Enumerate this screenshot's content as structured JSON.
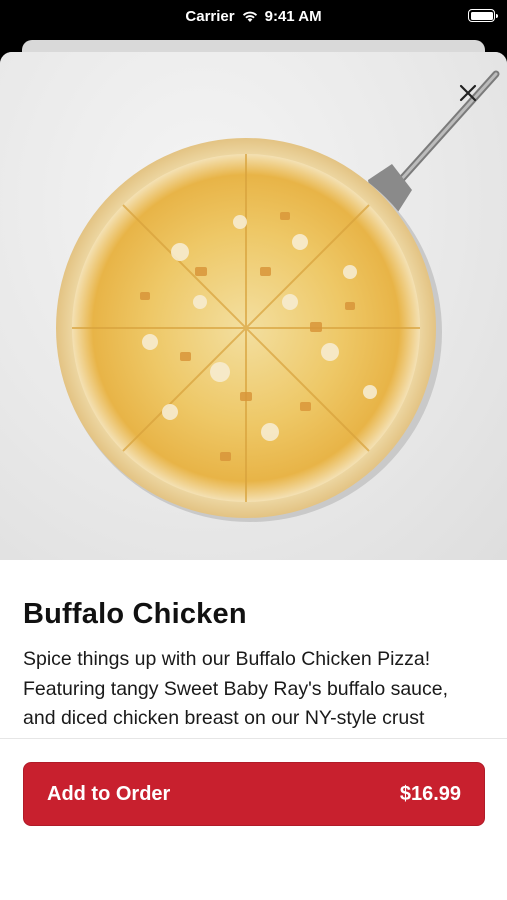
{
  "status_bar": {
    "carrier": "Carrier",
    "time": "9:41 AM"
  },
  "product": {
    "title": "Buffalo Chicken",
    "description": "Spice things up with our Buffalo Chicken Pizza! Featuring tangy Sweet Baby Ray's buffalo sauce, and diced chicken breast on our NY-style crust",
    "image_alt": "Buffalo Chicken pizza"
  },
  "order_button": {
    "label": "Add to Order",
    "price": "$16.99"
  },
  "colors": {
    "accent": "#c8202e",
    "background": "#ffffff",
    "text": "#111111"
  },
  "icons": {
    "close": "close-icon",
    "wifi": "wifi-icon",
    "battery": "battery-icon"
  }
}
